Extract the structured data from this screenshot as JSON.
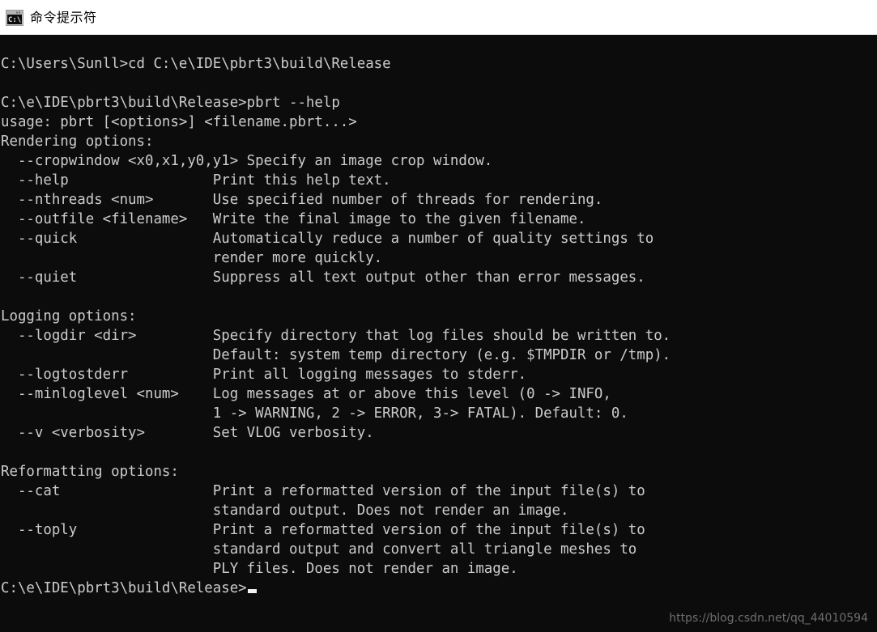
{
  "window": {
    "title": "命令提示符",
    "icon": "console-icon",
    "icon_label": "C:\\",
    "titlebar_bg": "#ffffff",
    "title_color": "#000000"
  },
  "terminal": {
    "background": "#0c0c0c",
    "foreground": "#cccccc",
    "cursor_color": "#f2f2f2",
    "lines": [
      "",
      "C:\\Users\\Sunll>cd C:\\e\\IDE\\pbrt3\\build\\Release",
      "",
      "C:\\e\\IDE\\pbrt3\\build\\Release>pbrt --help",
      "usage: pbrt [<options>] <filename.pbrt...>",
      "Rendering options:",
      "  --cropwindow <x0,x1,y0,y1> Specify an image crop window.",
      "  --help                 Print this help text.",
      "  --nthreads <num>       Use specified number of threads for rendering.",
      "  --outfile <filename>   Write the final image to the given filename.",
      "  --quick                Automatically reduce a number of quality settings to",
      "                         render more quickly.",
      "  --quiet                Suppress all text output other than error messages.",
      "",
      "Logging options:",
      "  --logdir <dir>         Specify directory that log files should be written to.",
      "                         Default: system temp directory (e.g. $TMPDIR or /tmp).",
      "  --logtostderr          Print all logging messages to stderr.",
      "  --minloglevel <num>    Log messages at or above this level (0 -> INFO,",
      "                         1 -> WARNING, 2 -> ERROR, 3-> FATAL). Default: 0.",
      "  --v <verbosity>        Set VLOG verbosity.",
      "",
      "Reformatting options:",
      "  --cat                  Print a reformatted version of the input file(s) to",
      "                         standard output. Does not render an image.",
      "  --toply                Print a reformatted version of the input file(s) to",
      "                         standard output and convert all triangle meshes to",
      "                         PLY files. Does not render an image."
    ],
    "prompt_final": "C:\\e\\IDE\\pbrt3\\build\\Release>"
  },
  "watermark": {
    "text": "https://blog.csdn.net/qq_44010594",
    "color": "#6e6e6e"
  }
}
